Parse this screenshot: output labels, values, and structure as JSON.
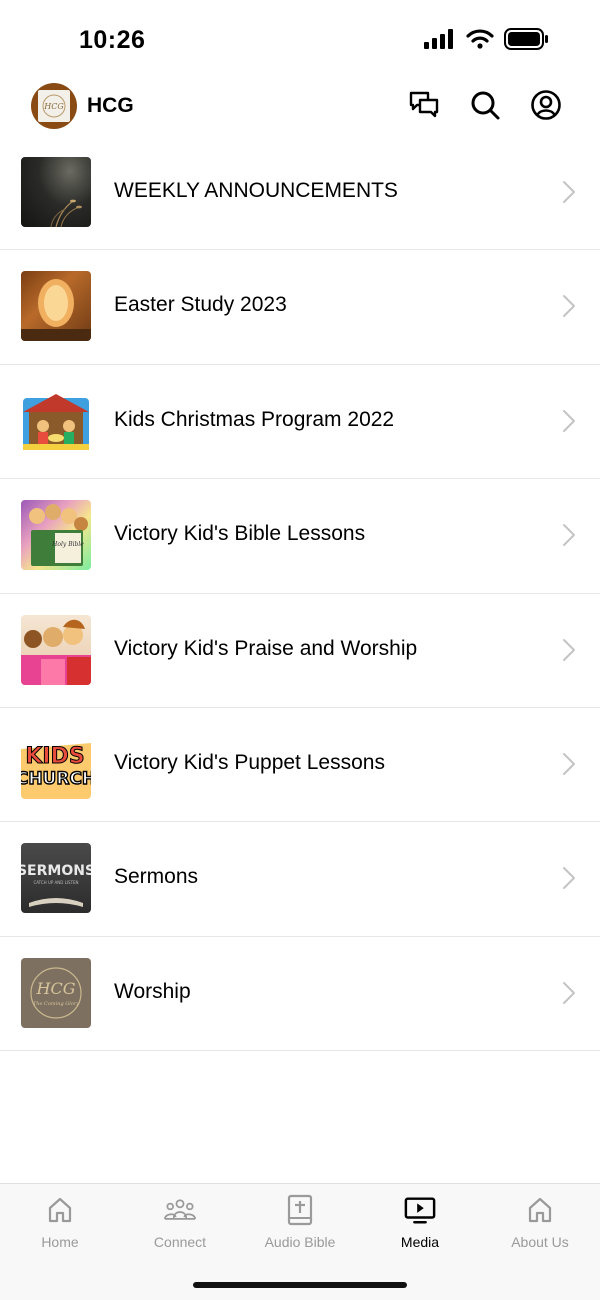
{
  "status_bar": {
    "time": "10:26",
    "icons": [
      "cellular-signal-icon",
      "wifi-icon",
      "battery-icon"
    ]
  },
  "header": {
    "app_title": "HCG",
    "logo_text": "HCG",
    "actions": [
      "chat-icon",
      "search-icon",
      "account-icon"
    ]
  },
  "media_list": [
    {
      "label": "WEEKLY ANNOUNCEMENTS"
    },
    {
      "label": "Easter Study 2023"
    },
    {
      "label": "Kids Christmas Program 2022"
    },
    {
      "label": "Victory Kid's Bible Lessons"
    },
    {
      "label": "Victory Kid's Praise and Worship"
    },
    {
      "label": "Victory Kid's Puppet Lessons"
    },
    {
      "label": "Sermons"
    },
    {
      "label": "Worship"
    }
  ],
  "thumb_text": {
    "bible": "Holy Bible",
    "kids": "KIDS",
    "church": "CHURCH",
    "sermons": "SERMONS",
    "sermons_sub": "CATCH UP AND LISTEN",
    "hcg": "HCG",
    "hcg_sub": "The Coming Glory"
  },
  "tab_bar": {
    "tabs": [
      {
        "label": "Home",
        "icon": "home-icon",
        "active": false
      },
      {
        "label": "Connect",
        "icon": "people-icon",
        "active": false
      },
      {
        "label": "Audio Bible",
        "icon": "bible-icon",
        "active": false
      },
      {
        "label": "Media",
        "icon": "media-icon",
        "active": true
      },
      {
        "label": "About Us",
        "icon": "home-icon",
        "active": false
      }
    ]
  },
  "colors": {
    "active_tab": "#000000",
    "inactive_tab": "#9a9a9a",
    "logo_ring": "#8a4a14",
    "divider": "#e6e6e6"
  }
}
